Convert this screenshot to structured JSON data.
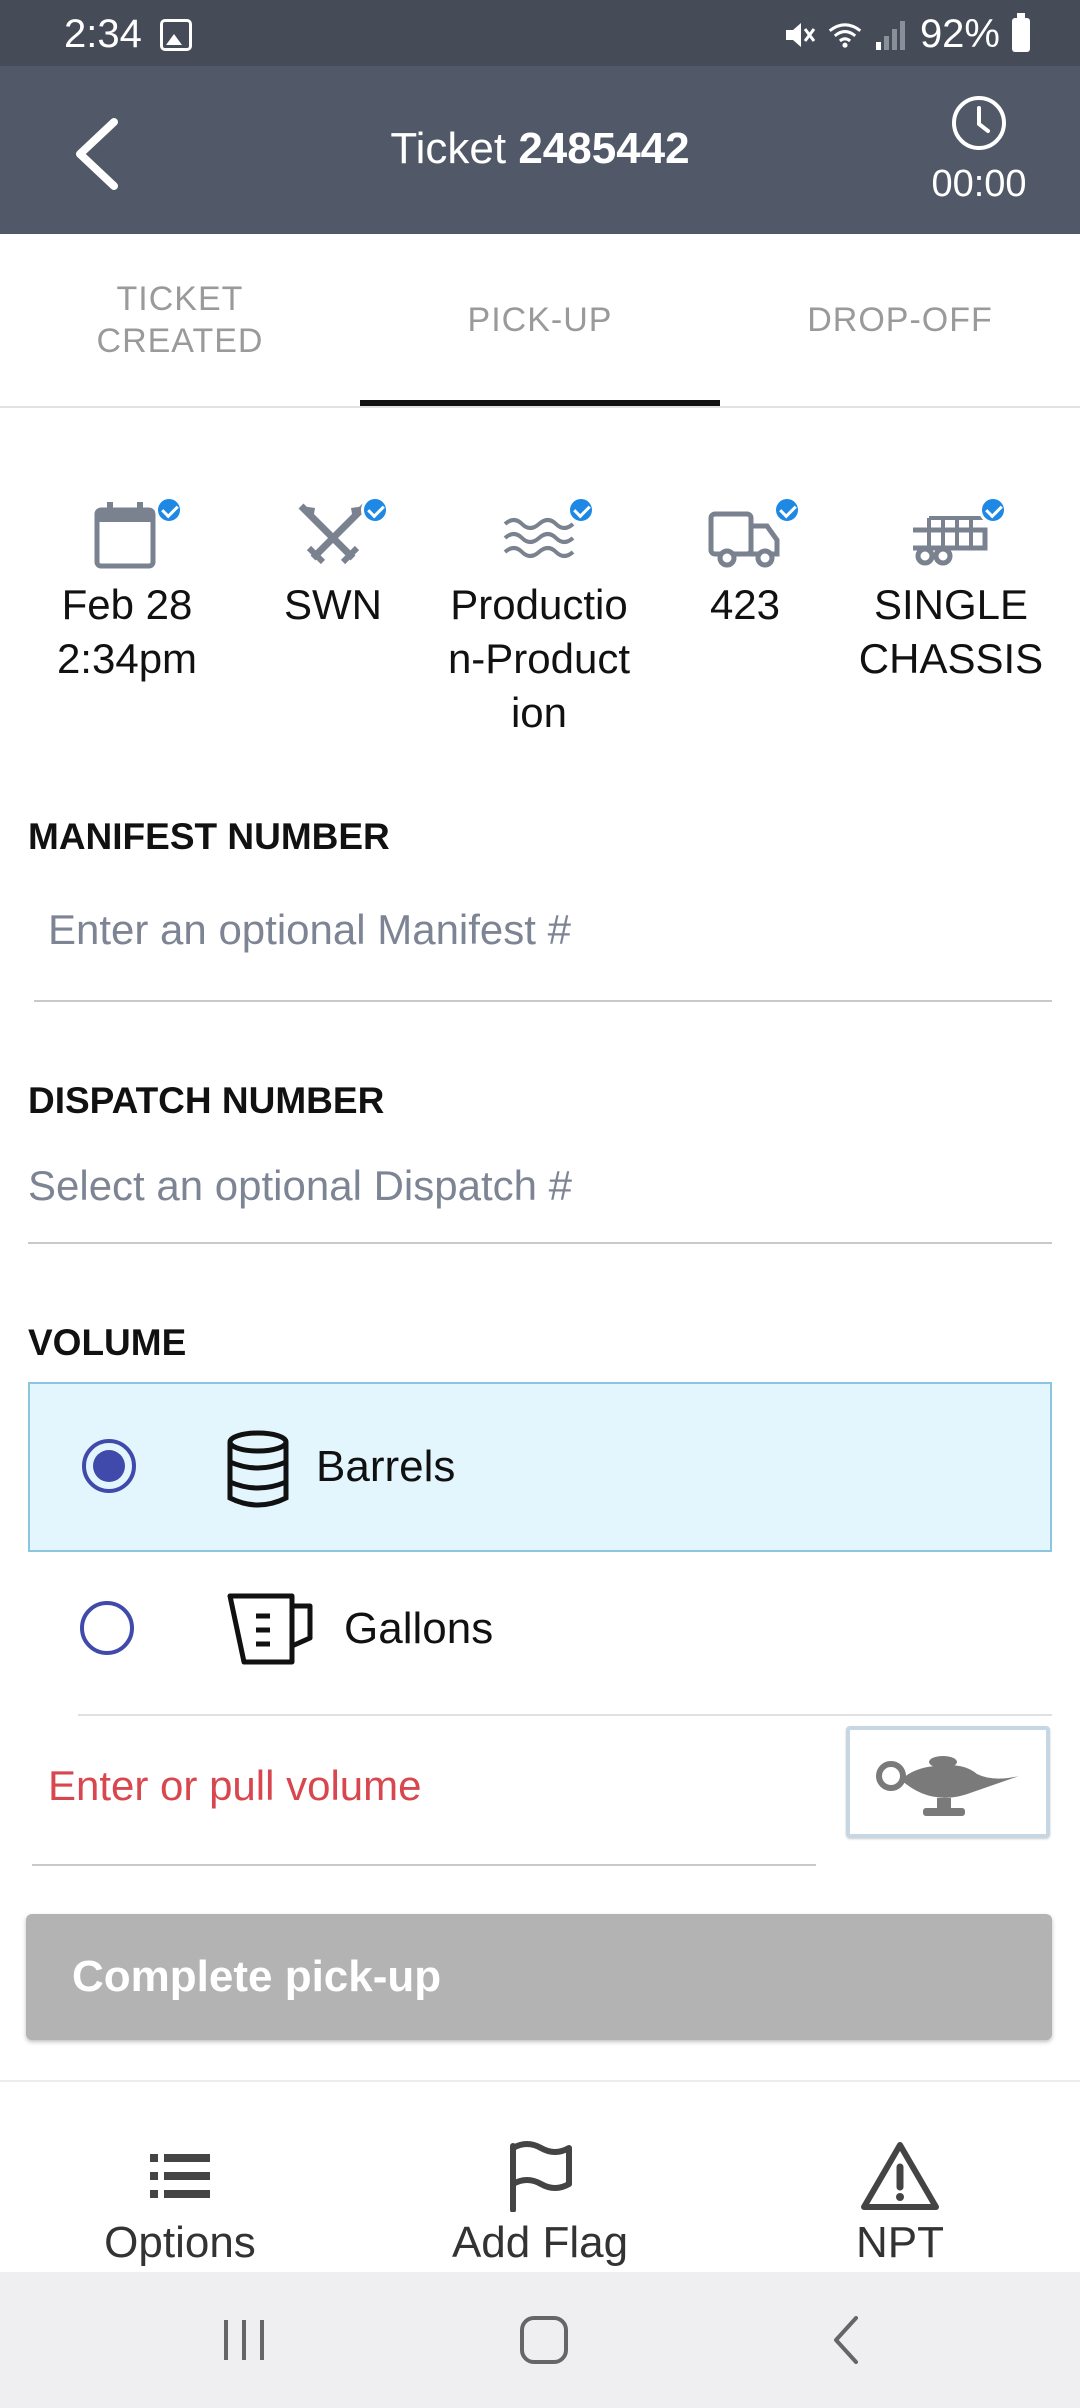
{
  "status_bar": {
    "time": "2:34",
    "battery": "92%"
  },
  "header": {
    "title_prefix": "Ticket",
    "ticket_number": "2485442",
    "timer": "00:00"
  },
  "tabs": [
    {
      "label": "TICKET\nCREATED",
      "active": false
    },
    {
      "label": "PICK-UP",
      "active": true
    },
    {
      "label": "DROP-OFF",
      "active": false
    }
  ],
  "summary": [
    {
      "icon": "calendar-icon",
      "value": "Feb 28\n2:34pm"
    },
    {
      "icon": "crossed-swords-icon",
      "value": "SWN"
    },
    {
      "icon": "water-waves-icon",
      "value": "Productio\nn-Product\nion"
    },
    {
      "icon": "truck-icon",
      "value": "423"
    },
    {
      "icon": "trailer-icon",
      "value": "SINGLE\nCHASSIS"
    }
  ],
  "manifest": {
    "label": "MANIFEST NUMBER",
    "placeholder": "Enter an optional Manifest #"
  },
  "dispatch": {
    "label": "DISPATCH NUMBER",
    "placeholder": "Select an optional Dispatch #"
  },
  "volume": {
    "label": "VOLUME",
    "options": [
      {
        "label": "Barrels",
        "icon": "barrel-icon",
        "selected": true
      },
      {
        "label": "Gallons",
        "icon": "measuring-jug-icon",
        "selected": false
      }
    ],
    "input_placeholder": "Enter or pull volume",
    "pull_icon": "magic-lamp-icon"
  },
  "complete_button": "Complete pick-up",
  "toolbar": [
    {
      "label": "Options",
      "icon": "list-icon"
    },
    {
      "label": "Add Flag",
      "icon": "flag-icon"
    },
    {
      "label": "NPT",
      "icon": "warning-icon"
    }
  ],
  "colors": {
    "header_bg": "#515867",
    "status_bg": "#454b57",
    "accent_blue": "#1e88e5",
    "radio": "#3f4aaa",
    "error_red": "#d9474e",
    "selected_bg": "#e3f5fd",
    "disabled_button": "#b3b3b3"
  }
}
